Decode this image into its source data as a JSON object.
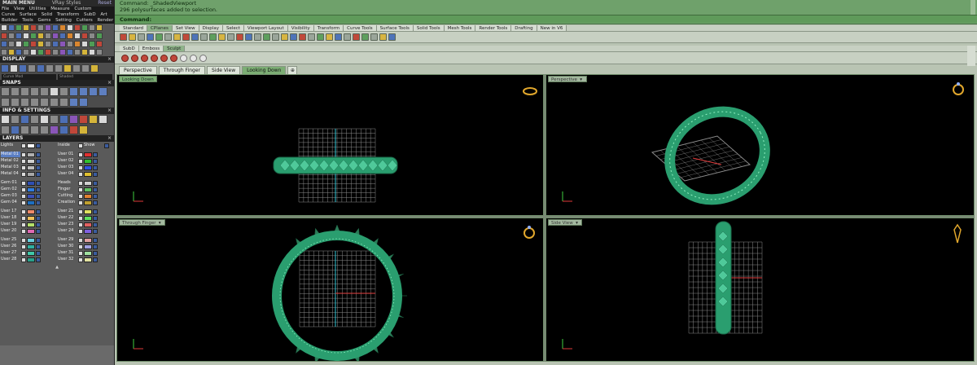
{
  "left_panel": {
    "title": "MAIN MENU",
    "subtitle": "VRay Styles",
    "reset": "Reset",
    "menu_row1": [
      "File",
      "View",
      "Utilities",
      "Measure",
      "Custom"
    ],
    "menu_row2": [
      "Curve",
      "Surface",
      "Solid",
      "Transform",
      "SubD",
      "Art"
    ],
    "menu_row3": [
      "Builder",
      "Tools",
      "Gems",
      "Setting",
      "Cutters",
      "Render"
    ],
    "display_header": "DISPLAY",
    "display_mode_left": "Curve Mod",
    "display_mode_right": "Shaded",
    "snaps_header": "SNAPS",
    "info_header": "INFO & SETTINGS",
    "layers_header": "LAYERS",
    "layers_top": {
      "left": "Lights",
      "mid": "Inside",
      "right": "Show"
    },
    "layer_groups": [
      {
        "left": [
          "Metal 01",
          "Metal 02",
          "Metal 03",
          "Metal 04"
        ],
        "right": [
          "User 01",
          "User 02",
          "User 03",
          "User 04"
        ]
      },
      {
        "left": [
          "Gem 01",
          "Gem 02",
          "Gem 03",
          "Gem 04"
        ],
        "right": [
          "Heads",
          "Finger",
          "Cutting",
          "Creation"
        ]
      },
      {
        "left": [
          "User 17",
          "User 18",
          "User 19",
          "User 20"
        ],
        "right": [
          "User 21",
          "User 22",
          "User 23",
          "User 24"
        ]
      },
      {
        "left": [
          "User 25",
          "User 26",
          "User 27",
          "User 28"
        ],
        "right": [
          "User 29",
          "User 30",
          "User 31",
          "User 32"
        ]
      }
    ],
    "colors": {
      "panel_bg": "#6a6a6a",
      "selected_blue": "#5a7ec4"
    }
  },
  "command": {
    "line1": "Command: _ShadedViewport",
    "line2": "296 polysurfaces added to selection.",
    "prompt": "Command:"
  },
  "toolbar_tabs": [
    "Standard",
    "CPlanes",
    "Set View",
    "Display",
    "Select",
    "Viewport Layout",
    "Visibility",
    "Transform",
    "Curve Tools",
    "Surface Tools",
    "Solid Tools",
    "Mesh Tools",
    "Render Tools",
    "Drafting",
    "New in V6"
  ],
  "toolbar_tabs_active": 1,
  "subd_tabs": [
    "SubD",
    "Emboss",
    "Sculpt"
  ],
  "subd_tabs_active": 2,
  "viewport_tabs": [
    "Perspective",
    "Through Finger",
    "Side View",
    "Looking Down"
  ],
  "viewport_tabs_active": 3,
  "viewports": {
    "top_left": "Looking Down",
    "top_right": "Perspective",
    "bottom_left": "Through Finger",
    "bottom_right": "Side View"
  },
  "colors": {
    "command_bg": "#6fa16b",
    "ring_green": "#2a9e6f",
    "viewport_bg": "#000000",
    "grid": "#8a8a8a"
  }
}
